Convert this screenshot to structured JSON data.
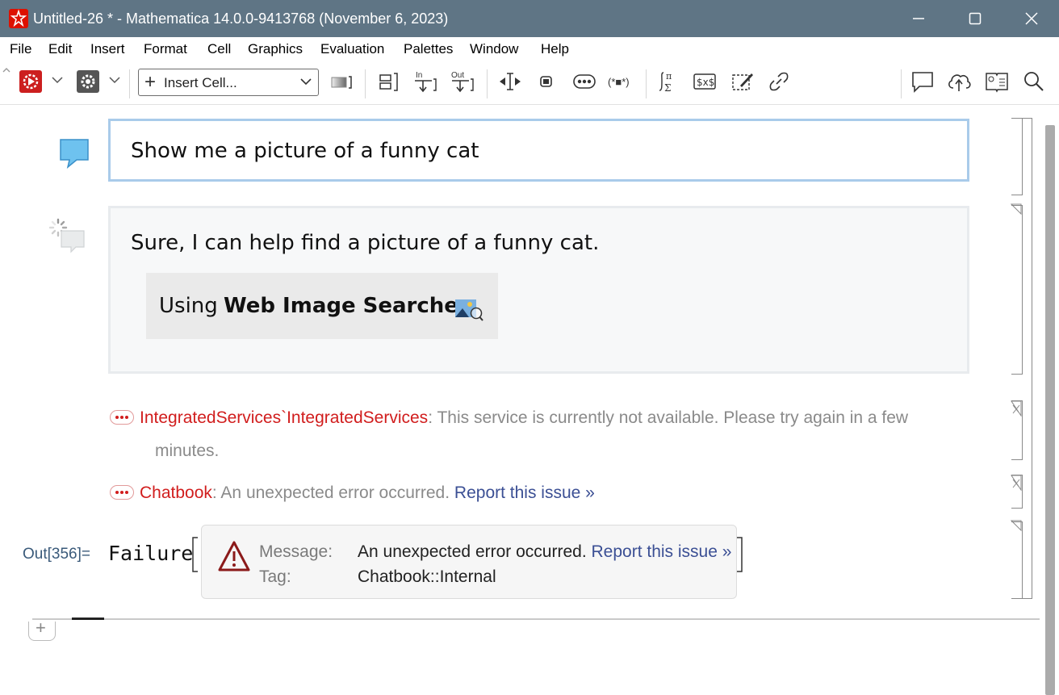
{
  "window": {
    "title": "Untitled-26 * - Mathematica 14.0.0-9413768 (November 6, 2023)",
    "minimize_icon": "minimize-icon",
    "maximize_icon": "maximize-icon",
    "close_icon": "close-icon",
    "titlebar_color": "#5f7585"
  },
  "menu": [
    "File",
    "Edit",
    "Insert",
    "Format",
    "Cell",
    "Graphics",
    "Evaluation",
    "Palettes",
    "Window",
    "Help"
  ],
  "toolbar": {
    "insert_cell_label": "Insert Cell...",
    "in_label": "In",
    "out_label": "Out",
    "delimiter_label": "(*■*)"
  },
  "notebook": {
    "user_prompt": "Show me a picture of a funny cat",
    "assistant_reply": "Sure, I can help find a picture of a funny cat.",
    "tool_using_prefix": "Using",
    "tool_name": "Web Image Searcher",
    "messages": [
      {
        "head": "IntegratedServices`IntegratedServices",
        "sep": ": ",
        "body_line1": "This service is currently not available. Please try again in a few",
        "body_line2": "minutes."
      },
      {
        "head": "Chatbook",
        "sep": ": ",
        "body": "An unexpected error occurred.",
        "link": "Report this issue »"
      }
    ],
    "output": {
      "label": "Out[356]=",
      "head": "Failure",
      "message_key": "Message:",
      "message_value": "An unexpected error occurred.",
      "message_link": "Report this issue »",
      "tag_key": "Tag:",
      "tag_value": "Chatbook::Internal"
    },
    "colors": {
      "user_border": "#a9cbea",
      "message_red": "#d11d1d",
      "link_blue": "#3b4f94"
    }
  }
}
